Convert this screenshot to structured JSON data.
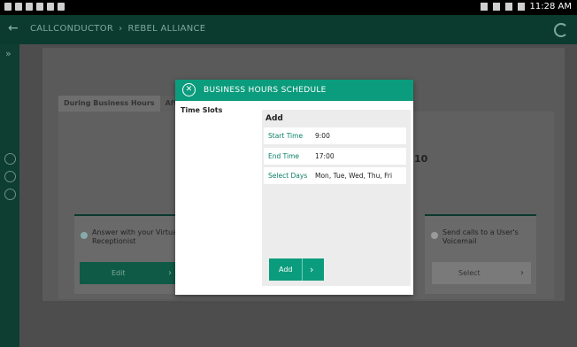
{
  "status_bar": {
    "time": "11:28 AM"
  },
  "app_bar": {
    "breadcrumb": [
      "CALLCONDUCTOR",
      "REBEL ALLIANCE"
    ],
    "separator": "›",
    "back_icon": "arrow-left-icon",
    "refresh_icon": "refresh-icon"
  },
  "background": {
    "tabs": [
      "During Business Hours",
      "After Hours"
    ],
    "partial_number": "10",
    "options": [
      {
        "label": "Answer with your Virtual Receptionist",
        "button": "Edit"
      },
      {
        "label": "Send calls to a User's Voicemail",
        "button": "Select"
      }
    ]
  },
  "modal": {
    "title": "BUSINESS HOURS SCHEDULE",
    "time_slots_label": "Time Slots",
    "form": {
      "title": "Add",
      "rows": [
        {
          "label": "Start Time",
          "value": "9:00"
        },
        {
          "label": "End Time",
          "value": "17:00"
        },
        {
          "label": "Select Days",
          "value": "Mon, Tue, Wed, Thu, Fri"
        }
      ],
      "add_label": "Add"
    }
  },
  "colors": {
    "accent": "#0b9c7d",
    "app_bar": "#0b3a2f",
    "label_green": "#0b7f67"
  }
}
